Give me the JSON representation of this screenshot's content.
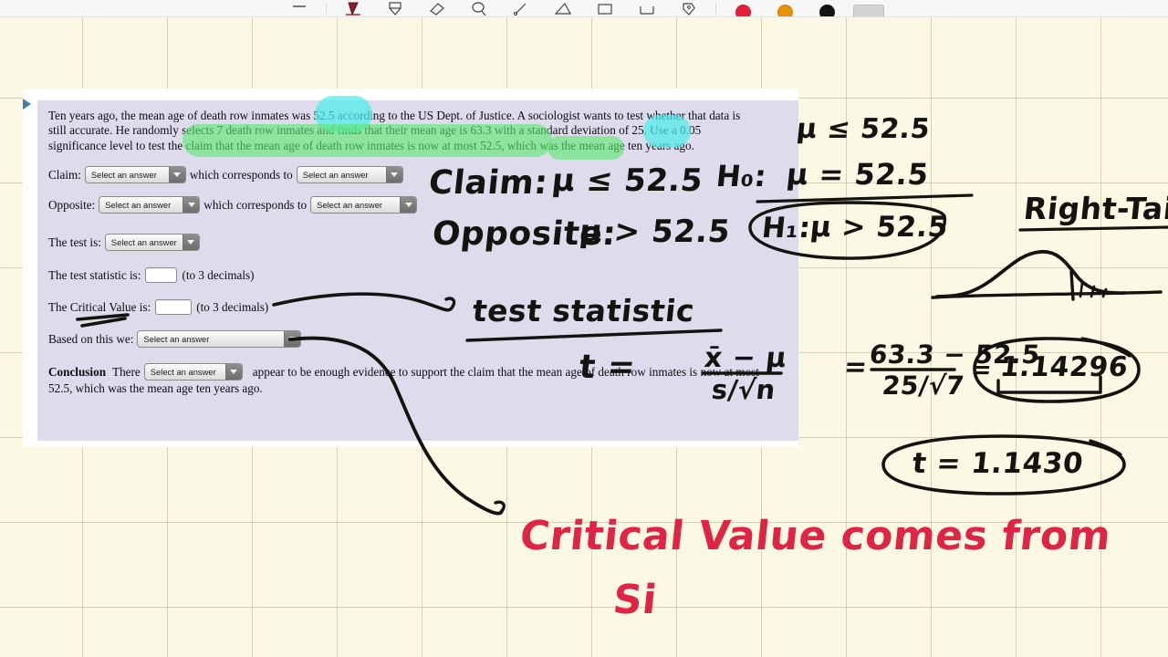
{
  "toolbar": {
    "tools": [
      {
        "name": "minus-tool",
        "label": "Minus"
      },
      {
        "name": "pen-tool",
        "label": "Pen"
      },
      {
        "name": "highlighter-tool",
        "label": "Highlighter"
      },
      {
        "name": "eraser-tool",
        "label": "Eraser"
      },
      {
        "name": "lasso-tool",
        "label": "Lasso Select"
      },
      {
        "name": "line-tool",
        "label": "Line"
      },
      {
        "name": "shape-tool",
        "label": "Shape"
      },
      {
        "name": "rectangle-tool",
        "label": "Rectangle"
      },
      {
        "name": "angle-tool",
        "label": "Angle"
      },
      {
        "name": "tag-tool",
        "label": "Tag"
      }
    ],
    "colors": [
      {
        "name": "color-swatch-red",
        "hex": "#e0213a"
      },
      {
        "name": "color-swatch-orange",
        "hex": "#e8920c"
      },
      {
        "name": "color-swatch-black",
        "hex": "#141414"
      },
      {
        "name": "color-swatch-grey",
        "hex": "#d4d4d4"
      }
    ]
  },
  "panel": {
    "problem": {
      "line1": "Ten years ago, the mean age of death row inmates was 52.5 according to the US Dept. of Justice. A sociologist wants to test whether that data is",
      "line2": "still accurate. He randomly selects 7 death row inmates and finds that their mean age is 63.3 with a standard deviation of 25. Use a 0.05",
      "line3": "significance level to test the claim that the mean age of death row inmates is now at most 52.5, which was the mean age ten years ago."
    },
    "claim_label": "Claim:",
    "opposite_label": "Opposite:",
    "corresponds_text": "which corresponds to",
    "test_is_label": "The test is:",
    "test_statistic_label": "The test statistic is:",
    "critical_value_label": "The Critical Value is:",
    "to3decimals": "(to 3 decimals)",
    "based_on_label": "Based on this we:",
    "conclusion_bold": "Conclusion",
    "conclusion_there": "There",
    "conclusion_tail": "appear to be enough evidence to support the claim that the mean age of death row inmates is now at most",
    "conclusion_line2": "52.5, which was the mean age ten years ago.",
    "select_placeholder": "Select an answer",
    "test_statistic_value": "",
    "critical_value_value": ""
  },
  "handwriting": {
    "claim_label": "Claim:",
    "claim_expr": "μ ≤ 52.5",
    "opposite_label": "Opposite:",
    "opposite_expr": "μ > 52.5",
    "h0_label": "H₀:",
    "h0_expr": "μ = 52.5",
    "h1_label": "H₁:",
    "h1_expr": "μ > 52.5",
    "hyp_top": "μ ≤ 52.5",
    "hyp_bottom": "μ = 52.5",
    "right_tail": "Right-Tail",
    "test_statistic_caption": "test statistic",
    "t_eq": "t =",
    "formula_num": "x̄ − μ",
    "formula_den": "s/√n",
    "equals": "=",
    "values_num": "63.3 − 52.5",
    "values_den": "25/√7",
    "result_eq": "=",
    "result_value": "1.14296",
    "t_final": "t = 1.1430",
    "red_line1": "Critical Value comes from",
    "red_line2": "Si"
  },
  "colors": {
    "paper": "#fbf8e3",
    "grid_line": "#b7b296",
    "panel_bg": "#dedcec",
    "card_bg": "#ffffff",
    "ink_black": "#14130f",
    "ink_red": "#e02446",
    "highlight_green": "#5ce86e",
    "highlight_cyan": "#4eebea",
    "triangle_blue": "#3d7fad"
  }
}
